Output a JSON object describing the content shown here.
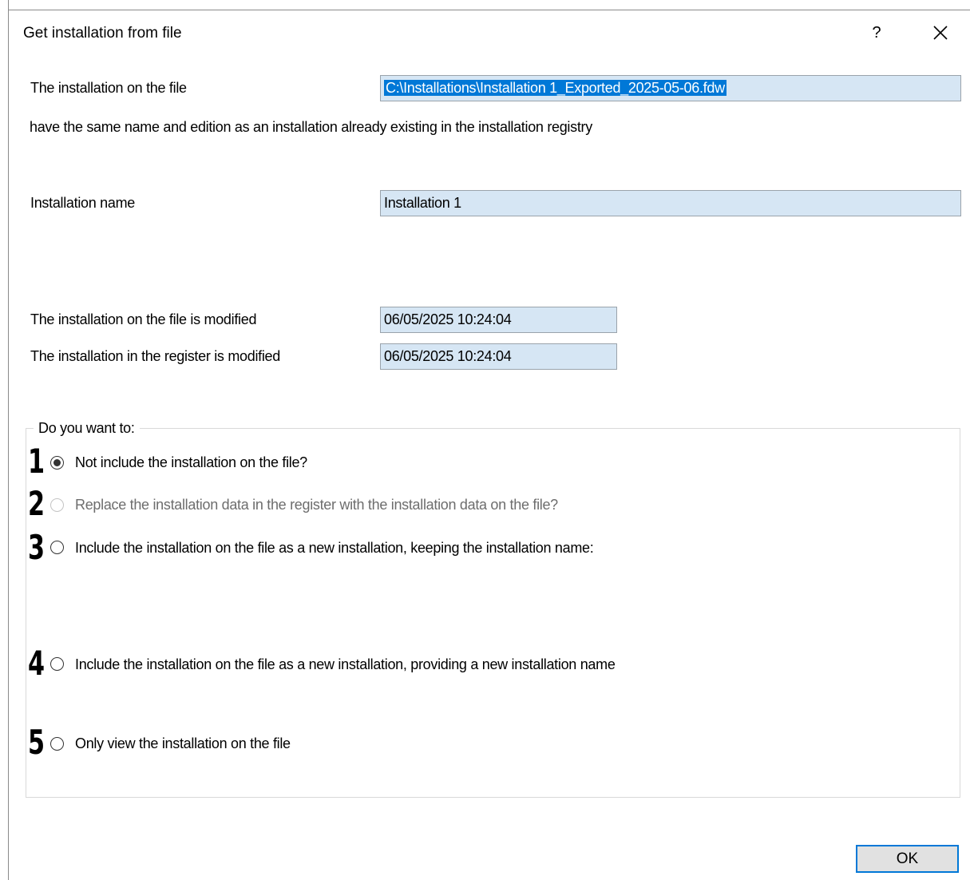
{
  "window": {
    "title": "Get installation from file",
    "help_label": "?",
    "close_icon": "close-icon"
  },
  "file_row": {
    "label": "The installation on the file",
    "value": "C:\\Installations\\Installation 1_Exported_2025-05-06.fdw"
  },
  "message": "have the same name and edition as an installation already existing in the installation registry",
  "name_row": {
    "label": "Installation name",
    "value": "Installation 1"
  },
  "file_modified": {
    "label": "The installation on the file is modified",
    "value": "06/05/2025 10:24:04"
  },
  "register_modified": {
    "label": "The installation in the register is modified",
    "value": "06/05/2025 10:24:04"
  },
  "options_group": {
    "legend": "Do you want to:",
    "options": [
      {
        "number": "1",
        "label": "Not include the installation on the file?",
        "checked": true,
        "enabled": true
      },
      {
        "number": "2",
        "label": "Replace the installation data in the register with the installation data on the file?",
        "checked": false,
        "enabled": false
      },
      {
        "number": "3",
        "label": "Include the installation on the file as a new installation, keeping the installation name:",
        "checked": false,
        "enabled": true
      },
      {
        "number": "4",
        "label": "Include the installation on the file as a new installation, providing a new installation name",
        "checked": false,
        "enabled": true
      },
      {
        "number": "5",
        "label": "Only view the installation on the file",
        "checked": false,
        "enabled": true
      }
    ]
  },
  "ok_button": {
    "label": "OK"
  },
  "colors": {
    "field_background": "#d6e6f4",
    "selection": "#0078d7",
    "ok_border": "#0078d7"
  }
}
